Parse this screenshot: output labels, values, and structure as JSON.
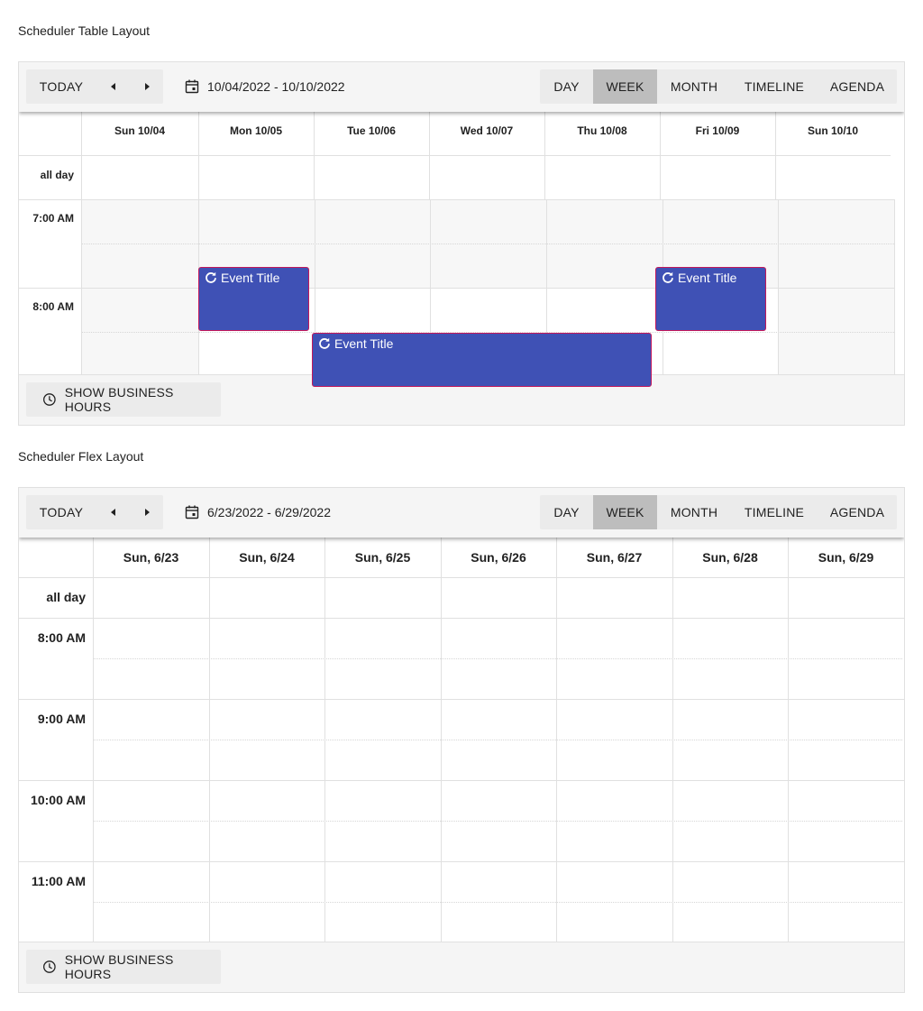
{
  "table_layout": {
    "section_title": "Scheduler Table Layout",
    "toolbar": {
      "today_label": "TODAY",
      "date_range": "10/04/2022 - 10/10/2022",
      "views": [
        "DAY",
        "WEEK",
        "MONTH",
        "TIMELINE",
        "AGENDA"
      ],
      "active_view": "WEEK"
    },
    "days": [
      "Sun 10/04",
      "Mon 10/05",
      "Tue 10/06",
      "Wed 10/07",
      "Thu 10/08",
      "Fri 10/09",
      "Sun 10/10"
    ],
    "all_day_label": "all day",
    "time_labels": [
      "7:00 AM",
      "8:00 AM"
    ],
    "events": [
      {
        "title": "Event Title",
        "recurring": true
      },
      {
        "title": "Event Title",
        "recurring": true
      },
      {
        "title": "Event Title",
        "recurring": true
      }
    ],
    "footer": {
      "business_hours_label": "SHOW BUSINESS HOURS"
    }
  },
  "flex_layout": {
    "section_title": "Scheduler Flex Layout",
    "toolbar": {
      "today_label": "TODAY",
      "date_range": "6/23/2022 - 6/29/2022",
      "views": [
        "DAY",
        "WEEK",
        "MONTH",
        "TIMELINE",
        "AGENDA"
      ],
      "active_view": "WEEK"
    },
    "days": [
      "Sun, 6/23",
      "Sun, 6/24",
      "Sun, 6/25",
      "Sun, 6/26",
      "Sun, 6/27",
      "Sun, 6/28",
      "Sun, 6/29"
    ],
    "all_day_label": "all day",
    "time_labels": [
      "8:00 AM",
      "9:00 AM",
      "10:00 AM",
      "11:00 AM"
    ],
    "footer": {
      "business_hours_label": "SHOW BUSINESS HOURS"
    }
  },
  "colors": {
    "event_fill": "#3f51b5",
    "event_border": "#c2185b",
    "toolbar_bg": "#f5f5f5",
    "active_view_bg": "#bdbdbd"
  },
  "icons": {
    "prev": "arrow-left-icon",
    "next": "arrow-right-icon",
    "calendar": "calendar-icon",
    "clock": "clock-icon",
    "recurrence": "recurrence-icon"
  }
}
